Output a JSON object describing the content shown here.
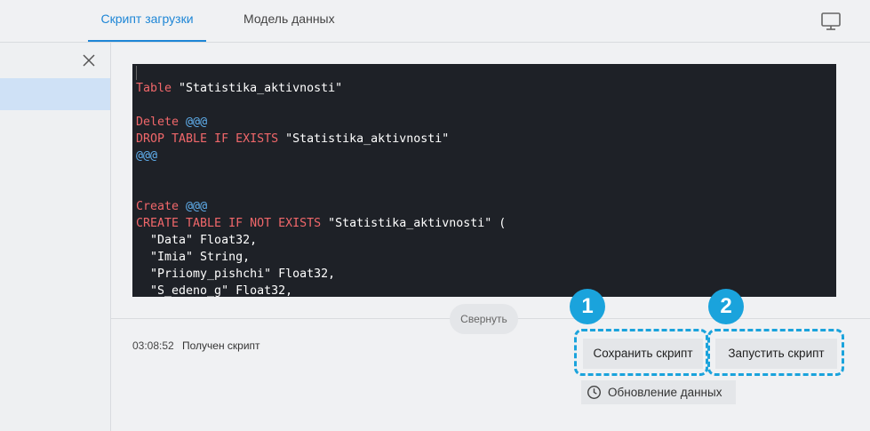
{
  "tabs": [
    {
      "label": "Скрипт загрузки",
      "active": true
    },
    {
      "label": "Модель данных",
      "active": false
    }
  ],
  "icons": {
    "monitor": "monitor-icon",
    "close": "close-icon",
    "clock": "clock-icon"
  },
  "colors": {
    "accent": "#1e86d6",
    "annotation": "#1aa3dc",
    "editor_bg": "#1e2127",
    "keyword": "#f0676a",
    "delimiter": "#61b1f0"
  },
  "editor": {
    "lines": [
      {
        "kw": "Table",
        "dl": "",
        "rest": " \"Statistika_aktivnosti\""
      },
      {
        "kw": "",
        "dl": "",
        "rest": ""
      },
      {
        "kw": "Delete",
        "dl": " @@@",
        "rest": ""
      },
      {
        "kw": "DROP TABLE IF EXISTS",
        "dl": "",
        "rest": " \"Statistika_aktivnosti\""
      },
      {
        "kw": "",
        "dl": "@@@",
        "rest": ""
      },
      {
        "kw": "",
        "dl": "",
        "rest": ""
      },
      {
        "kw": "",
        "dl": "",
        "rest": ""
      },
      {
        "kw": "Create",
        "dl": " @@@",
        "rest": ""
      },
      {
        "kw": "CREATE TABLE IF NOT EXISTS",
        "dl": "",
        "rest": " \"Statistika_aktivnosti\" ("
      },
      {
        "kw": "",
        "dl": "",
        "rest": "  \"Data\" Float32,"
      },
      {
        "kw": "",
        "dl": "",
        "rest": "  \"Imia\" String,"
      },
      {
        "kw": "",
        "dl": "",
        "rest": "  \"Priiomy_pishchi\" Float32,"
      },
      {
        "kw": "",
        "dl": "",
        "rest": "  \"S_edeno_g\" Float32,"
      }
    ]
  },
  "collapse_label": "Свернуть",
  "log": {
    "time": "03:08:52",
    "message": "Получен скрипт"
  },
  "buttons": {
    "save": "Сохранить скрипт",
    "run": "Запустить скрипт"
  },
  "badges": [
    "1",
    "2"
  ],
  "update_label": "Обновление данных"
}
